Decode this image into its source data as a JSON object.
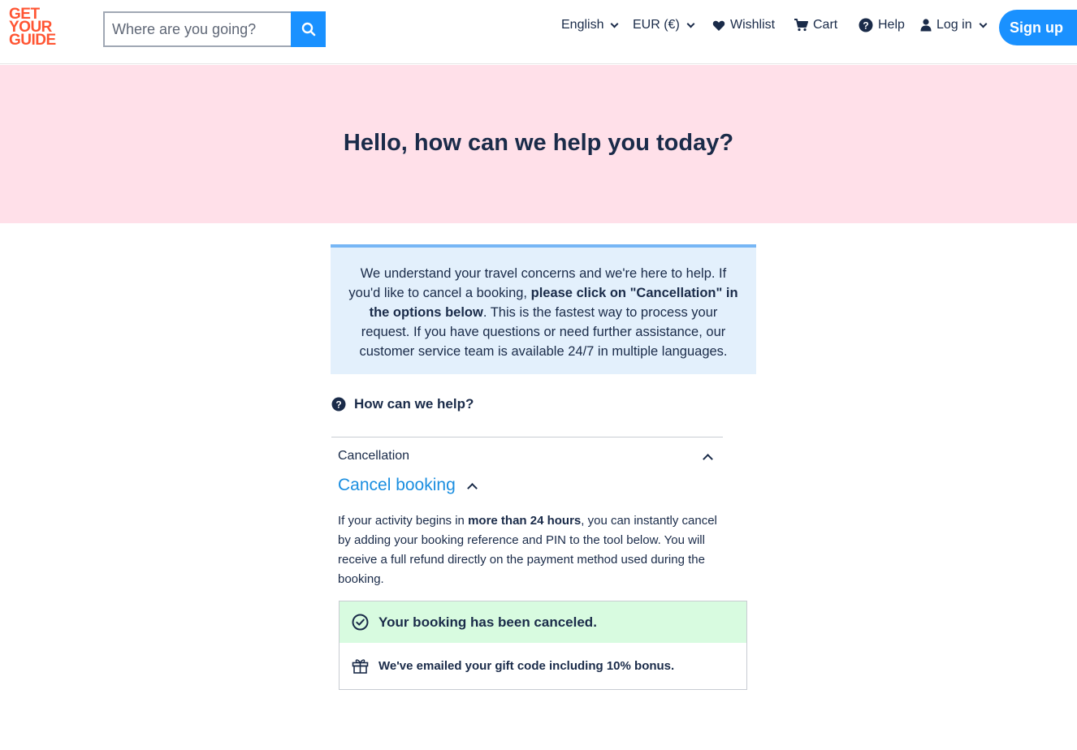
{
  "header": {
    "logo": [
      "GET",
      "YOUR",
      "GUIDE"
    ],
    "search_placeholder": "Where are you going?",
    "nav": {
      "language": "English",
      "currency": "EUR (€)",
      "wishlist": "Wishlist",
      "cart": "Cart",
      "help": "Help",
      "login": "Log in",
      "signup": "Sign up"
    }
  },
  "hero": {
    "title": "Hello, how can we help you today?"
  },
  "notice": {
    "text_before": "We understand your travel concerns and we're here to help. If you'd like to cancel a booking, ",
    "bold": "please click on \"Cancellation\" in the options below",
    "text_after": ". This is the fastest way to process your request. If you have questions or need further assistance, our customer service team is available 24/7 in multiple languages."
  },
  "help": {
    "heading": "How can we help?",
    "category": "Cancellation",
    "topic": "Cancel booking",
    "desc_before": "If your activity begins in ",
    "desc_bold": "more than 24 hours",
    "desc_after": ", you can instantly cancel by adding your booking reference and PIN to the tool below. You will receive a full refund directly on the payment method used during the booking."
  },
  "result": {
    "success": "Your booking has been canceled.",
    "gift": "We've emailed your gift code including 10% bonus."
  },
  "colors": {
    "brand": "#ff5533",
    "primary": "#1a91ff",
    "hero_bg": "#ffe0e9",
    "notice_bg": "#e3f0fc",
    "success_bg": "#d8fbe0",
    "text": "#1a2b49"
  }
}
